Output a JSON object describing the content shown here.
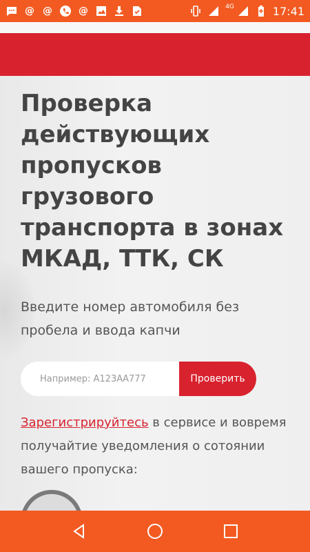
{
  "status_bar": {
    "time": "17:41",
    "network": "4G",
    "left_icons": [
      "message-icon",
      "at-icon",
      "at-icon",
      "phone-icon",
      "at-icon",
      "image-icon",
      "download-icon",
      "check-icon"
    ],
    "right_icons": [
      "vibrate-icon",
      "signal-icon",
      "battery-icon"
    ]
  },
  "colors": {
    "status_bar": "#f25a22",
    "accent_red": "#d8232f",
    "text_dark": "#444444"
  },
  "page": {
    "title": "Проверка действующих пропусков грузового транспорта в зонах МКАД, ТТК, СК",
    "subtitle": "Введите номер автомобиля без пробела и ввода капчи",
    "input_placeholder": "Например: А123АА777",
    "input_value": "",
    "check_button": "Проверить",
    "register_link": "Зарегистрируйтесь",
    "register_text": " в сервисе и вовремя получайтие уведомления о сотоянии вашего пропуска:"
  },
  "nav": {
    "back": "back-icon",
    "home": "home-icon",
    "recents": "recents-icon"
  }
}
